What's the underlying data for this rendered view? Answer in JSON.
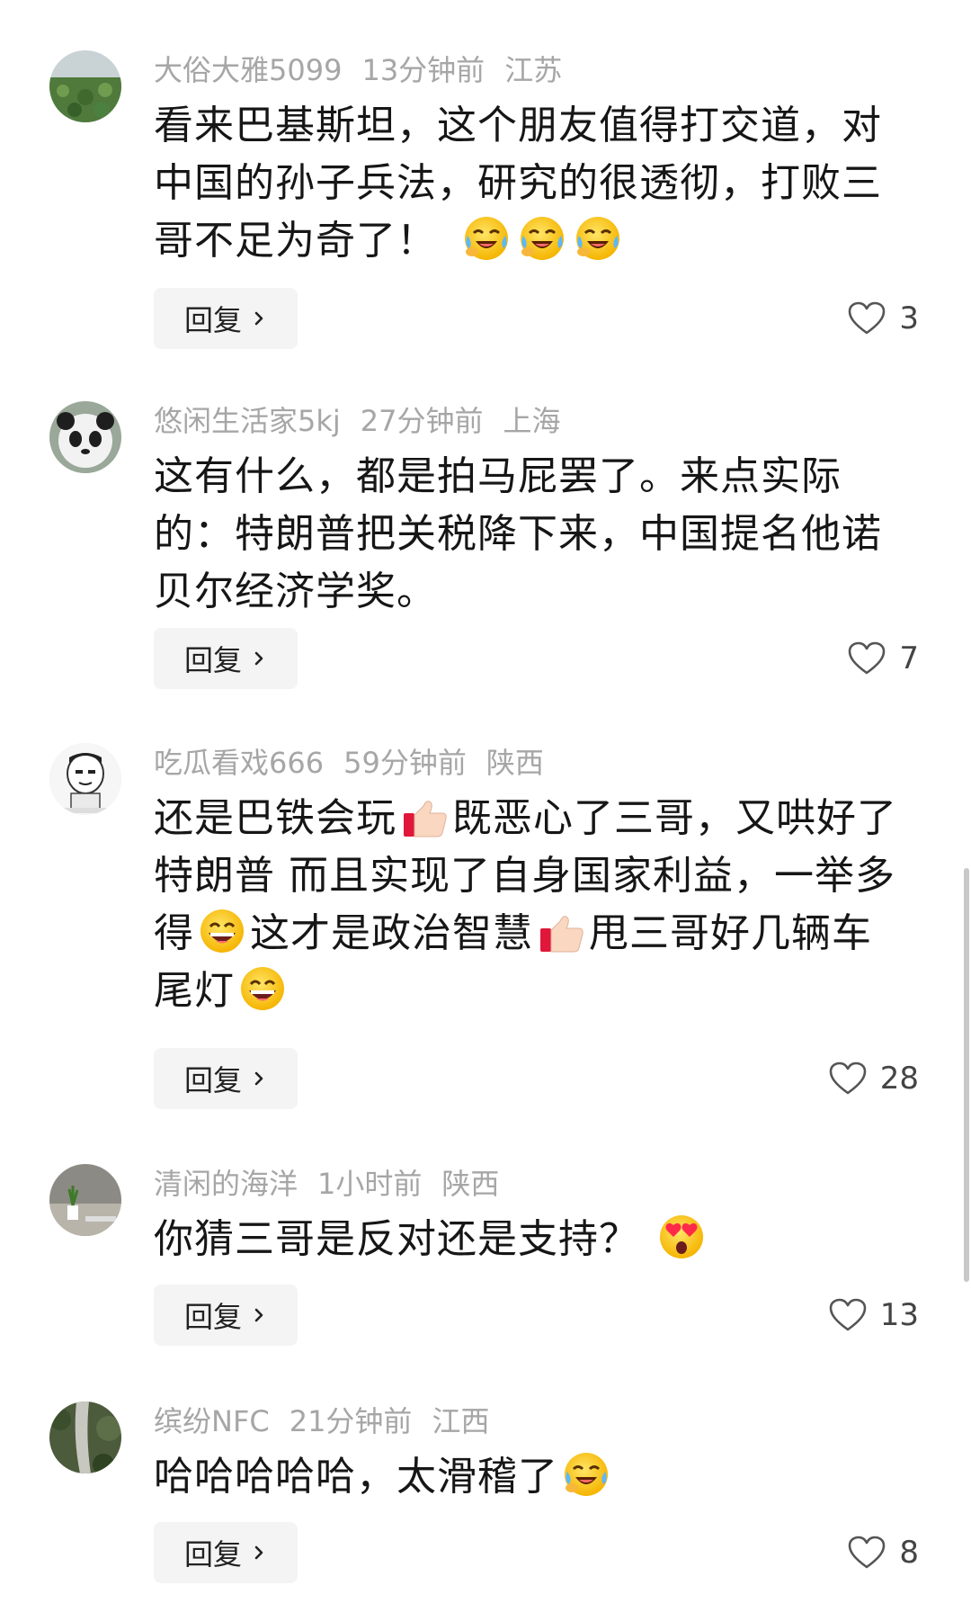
{
  "comments": [
    {
      "username": "大俗大雅5099",
      "time": "13分钟前",
      "location": "江苏",
      "lines": [
        "看来巴基斯坦，这个朋友值得打交道，对",
        "中国的孙子兵法，研究的很透彻，打败三",
        "哥不足为奇了！"
      ],
      "emojis": [
        "crying-laughing-emoji",
        "crying-laughing-emoji",
        "crying-laughing-emoji"
      ],
      "reply_label": "回复",
      "likes": "3"
    },
    {
      "username": "悠闲生活家5kj",
      "time": "27分钟前",
      "location": "上海",
      "lines": [
        "这有什么，都是拍马屁罢了。来点实际",
        "的：特朗普把关税降下来，中国提名他诺",
        "贝尔经济学奖。"
      ],
      "reply_label": "回复",
      "likes": "7"
    },
    {
      "username": "吃瓜看戏666",
      "time": "59分钟前",
      "location": "陕西",
      "line1_a": "还是巴铁会玩",
      "line1_b": "既恶心了三哥，又哄好了",
      "line2": "特朗普 而且实现了自身国家利益，一举多",
      "line3_a": "得",
      "line3_b": "这才是政治智慧",
      "line3_c": "甩三哥好几辆车",
      "line4": "尾灯",
      "emojis": [
        "thumbs-up-emoji",
        "grinning-emoji",
        "thumbs-up-emoji",
        "grinning-emoji"
      ],
      "reply_label": "回复",
      "likes": "28"
    },
    {
      "username": "清闲的海洋",
      "time": "1小时前",
      "location": "陕西",
      "lines": [
        "你猜三哥是反对还是支持？"
      ],
      "emojis": [
        "heart-eyes-emoji"
      ],
      "reply_label": "回复",
      "likes": "13"
    },
    {
      "username": "缤纷NFC",
      "time": "21分钟前",
      "location": "江西",
      "lines": [
        "哈哈哈哈哈，太滑稽了"
      ],
      "emojis": [
        "tears-of-joy-emoji"
      ],
      "reply_label": "回复",
      "likes": "8"
    }
  ],
  "colors": {
    "meta_text": "#a6a6a6",
    "body_text": "#161616",
    "reply_bg": "#f4f4f4"
  }
}
